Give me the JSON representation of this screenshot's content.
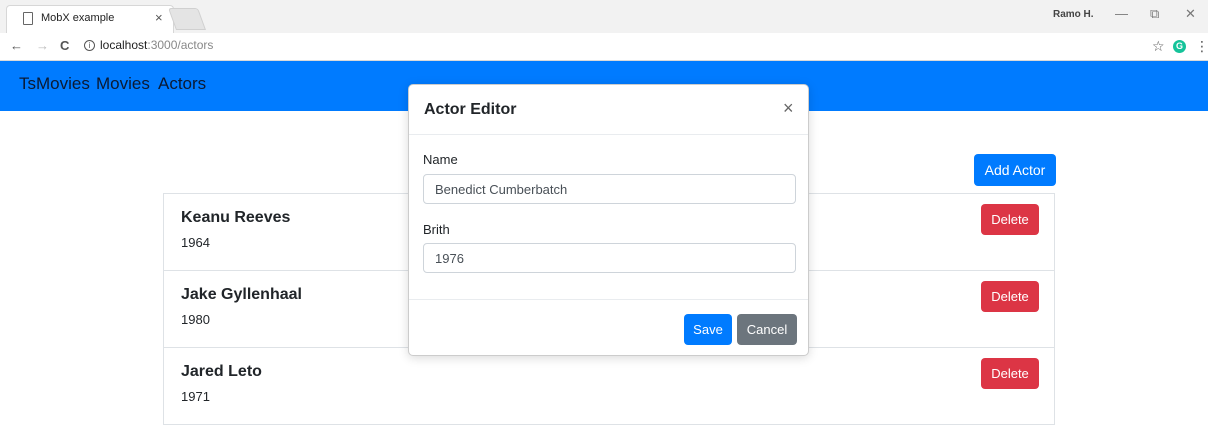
{
  "browser": {
    "tab_title": "MobX example",
    "tab_close": "×",
    "user": "Ramo H.",
    "url_host": "localhost",
    "url_path": ":3000/actors",
    "minimize": "—",
    "restore": "⧉",
    "close": "✕",
    "back": "←",
    "forward": "→",
    "reload": "C",
    "info": "i",
    "star": "☆",
    "ext": "G",
    "menu": "⋮"
  },
  "navbar": {
    "brand": "TsMovies",
    "links": [
      "Movies",
      "Actors"
    ],
    "color": "#007bff"
  },
  "add_actor_label": "Add Actor",
  "actors": [
    {
      "name": "Keanu Reeves",
      "year": "1964",
      "delete_label": "Delete"
    },
    {
      "name": "Jake Gyllenhaal",
      "year": "1980",
      "delete_label": "Delete"
    },
    {
      "name": "Jared Leto",
      "year": "1971",
      "delete_label": "Delete"
    }
  ],
  "modal": {
    "title": "Actor Editor",
    "close": "×",
    "name_label": "Name",
    "name_value": "Benedict Cumberbatch",
    "birth_label": "Brith",
    "birth_value": "1976",
    "save_label": "Save",
    "cancel_label": "Cancel"
  },
  "colors": {
    "primary": "#007bff",
    "danger": "#dc3545",
    "secondary": "#6c757d"
  }
}
